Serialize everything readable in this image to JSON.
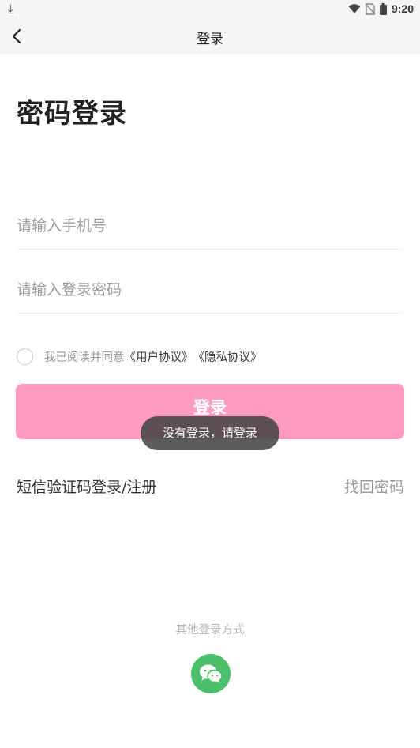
{
  "status_bar": {
    "time": "9:20",
    "icons": [
      "download-icon",
      "wifi-icon",
      "no-sim-icon",
      "battery-icon"
    ]
  },
  "nav": {
    "title": "登录",
    "back_icon": "chevron-left-icon"
  },
  "page": {
    "title": "密码登录"
  },
  "form": {
    "phone_placeholder": "请输入手机号",
    "phone_value": "",
    "password_placeholder": "请输入登录密码",
    "password_value": ""
  },
  "agreement": {
    "prefix": "我已阅读并同意",
    "user_agreement": "《用户协议》",
    "privacy_agreement": "《隐私协议》",
    "checked": false
  },
  "login_button": {
    "label": "登录",
    "color": "#ff9ac3"
  },
  "toast": {
    "text": "没有登录，请登录"
  },
  "links": {
    "sms_login": "短信验证码登录/注册",
    "forgot_password": "找回密码"
  },
  "other_login": {
    "label": "其他登录方式",
    "wechat_icon": "wechat-icon",
    "wechat_color": "#4cbf6b"
  }
}
